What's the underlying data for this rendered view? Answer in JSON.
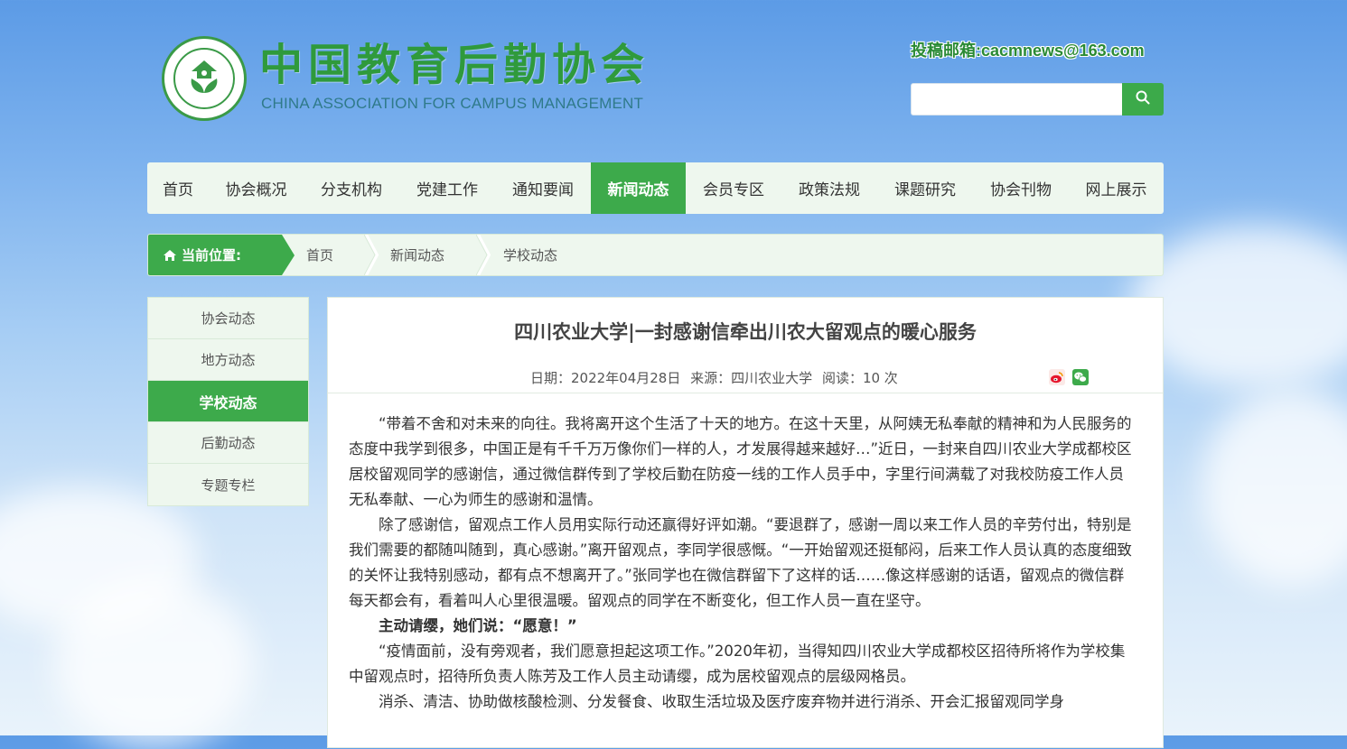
{
  "header": {
    "logo_cn": "中国教育后勤协会",
    "logo_en": "CHINA ASSOCIATION FOR CAMPUS MANAGEMENT",
    "logo_seal_text": "CHINA ASSOCIATION FOR CAMPUS MANAGEMENT 中国教育后勤协会",
    "submission_email": "投稿邮箱:cacmnews@163.com",
    "search_placeholder": ""
  },
  "nav": {
    "items": [
      {
        "label": "首页"
      },
      {
        "label": "协会概况"
      },
      {
        "label": "分支机构"
      },
      {
        "label": "党建工作"
      },
      {
        "label": "通知要闻"
      },
      {
        "label": "新闻动态"
      },
      {
        "label": "会员专区"
      },
      {
        "label": "政策法规"
      },
      {
        "label": "课题研究"
      },
      {
        "label": "协会刊物"
      },
      {
        "label": "网上展示"
      }
    ],
    "active_index": 5
  },
  "breadcrumb": {
    "here_label": "当前位置:",
    "items": [
      {
        "label": "首页"
      },
      {
        "label": "新闻动态"
      },
      {
        "label": "学校动态"
      }
    ]
  },
  "sidebar": {
    "items": [
      {
        "label": "协会动态"
      },
      {
        "label": "地方动态"
      },
      {
        "label": "学校动态"
      },
      {
        "label": "后勤动态"
      },
      {
        "label": "专题专栏"
      }
    ],
    "active_index": 2
  },
  "article": {
    "title": "四川农业大学|一封感谢信牵出川农大留观点的暖心服务",
    "date": "日期：2022年04月28日",
    "source": "来源：四川农业大学",
    "reads": "阅读：10 次",
    "paragraphs": [
      "“带着不舍和对未来的向往。我将离开这个生活了十天的地方。在这十天里，从阿姨无私奉献的精神和为人民服务的态度中我学到很多，中国正是有千千万万像你们一样的人，才发展得越来越好…”近日，一封来自四川农业大学成都校区居校留观同学的感谢信，通过微信群传到了学校后勤在防疫一线的工作人员手中，字里行间满载了对我校防疫工作人员无私奉献、一心为师生的感谢和温情。",
      "除了感谢信，留观点工作人员用实际行动还赢得好评如潮。“要退群了，感谢一周以来工作人员的辛劳付出，特别是我们需要的都随叫随到，真心感谢。”离开留观点，李同学很感慨。“一开始留观还挺郁闷，后来工作人员认真的态度细致的关怀让我特别感动，都有点不想离开了。”张同学也在微信群留下了这样的话……像这样感谢的话语，留观点的微信群每天都会有，看着叫人心里很温暖。留观点的同学在不断变化，但工作人员一直在坚守。",
      "主动请缨，她们说：“愿意！”",
      "“疫情面前，没有旁观者，我们愿意担起这项工作。”2020年初，当得知四川农业大学成都校区招待所将作为学校集中留观点时，招待所负责人陈芳及工作人员主动请缨，成为居校留观点的层级网格员。",
      "消杀、清洁、协助做核酸检测、分发餐食、收取生活垃圾及医疗废弃物并进行消杀、开会汇报留观同学身"
    ]
  },
  "icons": {
    "search": "search-icon",
    "home": "home-icon",
    "weibo": "weibo-icon",
    "wechat": "wechat-icon",
    "logo": "association-logo"
  },
  "colors": {
    "brand_green": "#3daa4b",
    "nav_bg": "#eef7ee",
    "text": "#333333"
  }
}
